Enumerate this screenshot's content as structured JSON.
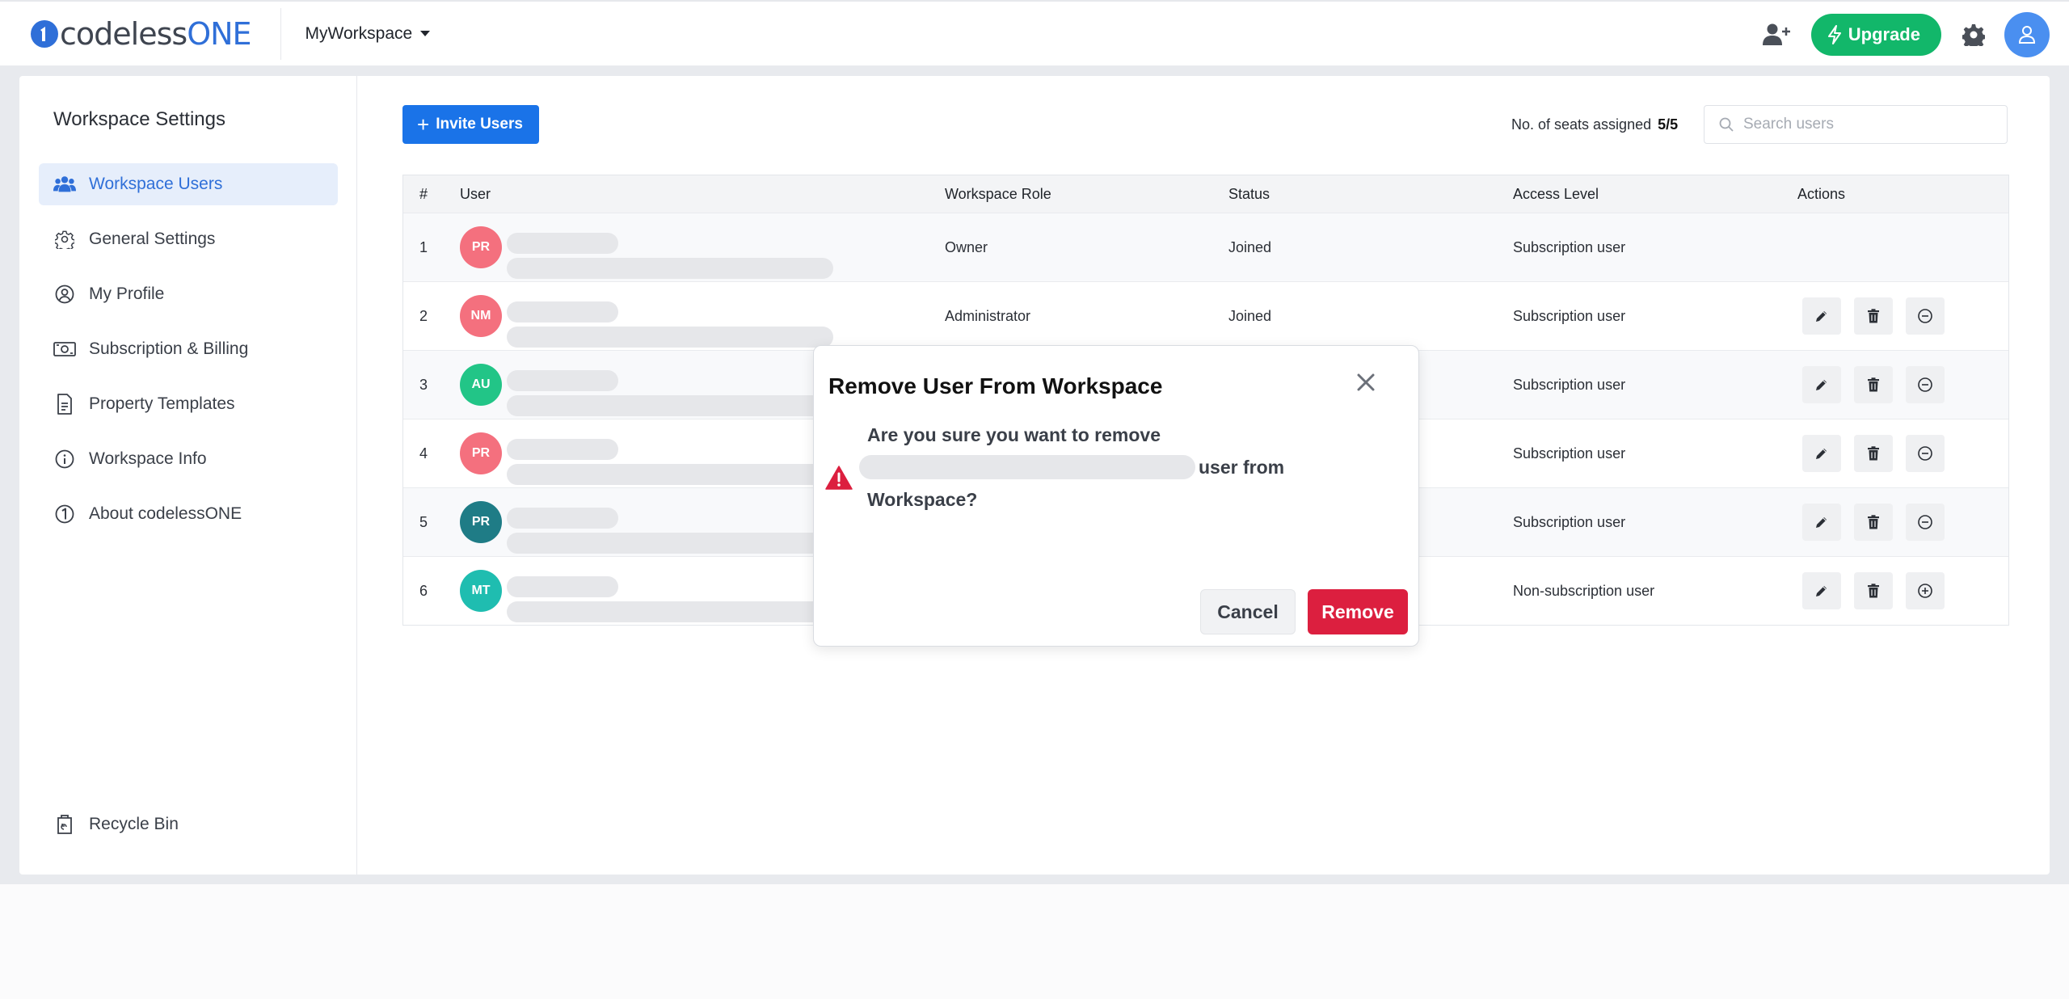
{
  "header": {
    "logo_text": "codeless",
    "logo_text_accent": "ONE",
    "workspace_name": "MyWorkspace",
    "upgrade_label": "Upgrade",
    "brand_color": "#2f6fd8",
    "upgrade_color": "#12b76a"
  },
  "sidebar": {
    "title": "Workspace Settings",
    "items": [
      {
        "label": "Workspace Users",
        "icon": "users-icon",
        "active": true
      },
      {
        "label": "General Settings",
        "icon": "gear-outline-icon"
      },
      {
        "label": "My Profile",
        "icon": "user-circle-icon"
      },
      {
        "label": "Subscription & Billing",
        "icon": "money-icon"
      },
      {
        "label": "Property Templates",
        "icon": "document-icon"
      },
      {
        "label": "Workspace Info",
        "icon": "info-icon"
      },
      {
        "label": "About codelessONE",
        "icon": "codelessone-icon"
      }
    ],
    "recycle_bin_label": "Recycle Bin"
  },
  "toolbar": {
    "invite_label": "Invite Users",
    "seats_label": "No. of seats assigned",
    "seats_value": "5/5",
    "search_placeholder": "Search users"
  },
  "table": {
    "columns": [
      "#",
      "User",
      "Workspace Role",
      "Status",
      "Access Level",
      "Actions"
    ],
    "rows": [
      {
        "num": "1",
        "initials": "PR",
        "color": "#f4707e",
        "role": "Owner",
        "status": "Joined",
        "access": "Subscription user",
        "actions": false
      },
      {
        "num": "2",
        "initials": "NM",
        "color": "#f4707e",
        "role": "Administrator",
        "status": "Joined",
        "access": "Subscription user",
        "actions": true,
        "toggle": "minus"
      },
      {
        "num": "3",
        "initials": "AU",
        "color": "#22c587",
        "role": "",
        "status": "",
        "access": "Subscription user",
        "actions": true,
        "toggle": "minus"
      },
      {
        "num": "4",
        "initials": "PR",
        "color": "#f4707e",
        "role": "",
        "status": "",
        "access": "Subscription user",
        "actions": true,
        "toggle": "minus"
      },
      {
        "num": "5",
        "initials": "PR",
        "color": "#1f7c86",
        "role": "",
        "status": "",
        "access": "Subscription user",
        "actions": true,
        "toggle": "minus"
      },
      {
        "num": "6",
        "initials": "MT",
        "color": "#1fbdb0",
        "role": "",
        "status": "",
        "access": "Non-subscription user",
        "actions": true,
        "toggle": "plus"
      }
    ]
  },
  "modal": {
    "title": "Remove User From Workspace",
    "message_start": "Are you sure you want to remove",
    "message_mid": "user from",
    "message_end": "Workspace?",
    "cancel_label": "Cancel",
    "remove_label": "Remove",
    "danger_color": "#dc1f3f"
  }
}
